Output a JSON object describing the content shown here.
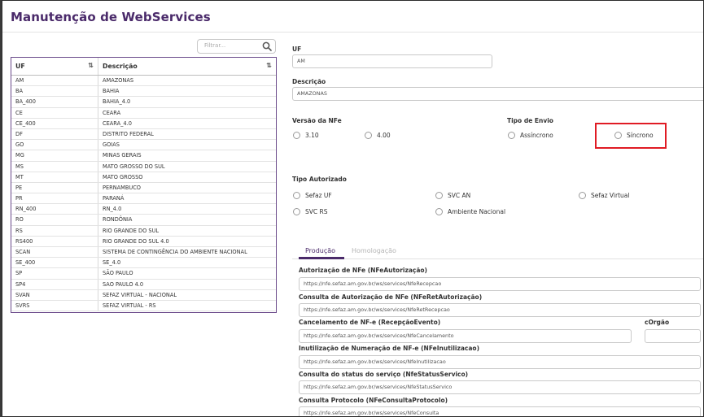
{
  "page_title": "Manutenção de WebServices",
  "filter": {
    "placeholder": "Filtrar...",
    "icon": "search-icon"
  },
  "grid": {
    "headers": [
      "UF",
      "Descrição"
    ],
    "rows": [
      [
        "AM",
        "AMAZONAS"
      ],
      [
        "BA",
        "BAHIA"
      ],
      [
        "BA_400",
        "BAHIA_4.0"
      ],
      [
        "CE",
        "CEARA"
      ],
      [
        "CE_400",
        "CEARA_4.0"
      ],
      [
        "DF",
        "DISTRITO FEDERAL"
      ],
      [
        "GO",
        "GOIAS"
      ],
      [
        "MG",
        "MINAS GERAIS"
      ],
      [
        "MS",
        "MATO GROSSO DO SUL"
      ],
      [
        "MT",
        "MATO GROSSO"
      ],
      [
        "PE",
        "PERNAMBUCO"
      ],
      [
        "PR",
        "PARANÁ"
      ],
      [
        "RN_400",
        "RN_4.0"
      ],
      [
        "RO",
        "RONDÔNIA"
      ],
      [
        "RS",
        "RIO GRANDE DO SUL"
      ],
      [
        "RS400",
        "RIO GRANDE DO SUL 4.0"
      ],
      [
        "SCAN",
        "SISTEMA DE CONTINGÊNCIA DO AMBIENTE NACIONAL"
      ],
      [
        "SE_400",
        "SE_4.0"
      ],
      [
        "SP",
        "SÃO PAULO"
      ],
      [
        "SP4",
        "SAO PAULO 4.0"
      ],
      [
        "SVAN",
        "SEFAZ VIRTUAL - NACIONAL"
      ],
      [
        "SVRS",
        "SEFAZ VIRTUAL - RS"
      ]
    ]
  },
  "form": {
    "uf": {
      "label": "UF",
      "value": "AM"
    },
    "descricao": {
      "label": "Descrição",
      "value": "AMAZONAS"
    },
    "versao": {
      "label": "Versão da NFe",
      "options": [
        "3.10",
        "4.00"
      ]
    },
    "tipo_envio": {
      "label": "Tipo de Envio",
      "options": [
        "Assíncrono",
        "Síncrono"
      ]
    },
    "tipo_autorizado": {
      "label": "Tipo Autorizado",
      "options": [
        "Sefaz UF",
        "SVC AN",
        "Sefaz Virtual",
        "SVC RS",
        "Ambiente Nacional"
      ]
    },
    "tabs": [
      "Produção",
      "Homologação"
    ],
    "services": [
      {
        "label": "Autorização de NFe (NFeAutorização)",
        "value": "https://nfe.sefaz.am.gov.br/ws/services/NfeRecepcao"
      },
      {
        "label": "Consulta de Autorização de NFe (NFeRetAutorização)",
        "value": "https://nfe.sefaz.am.gov.br/ws/services/NfeRetRecepcao"
      },
      {
        "label": "Cancelamento de NF-e (RecepçãoEvento)",
        "value": "https://nfe.sefaz.am.gov.br/ws/services/NfeCancelamento"
      },
      {
        "label": "Inutilização de Numeração de NF-e (NFeInutilizacao)",
        "value": "https://nfe.sefaz.am.gov.br/ws/services/NfeInutilizacao"
      },
      {
        "label": "Consulta do status do serviço (NfeStatusServico)",
        "value": "https://nfe.sefaz.am.gov.br/ws/services/NfeStatusServico"
      },
      {
        "label": "Consulta Protocolo (NFeConsultaProtocolo)",
        "value": "https://nfe.sefaz.am.gov.br/ws/services/NfeConsulta"
      }
    ],
    "corgao": {
      "label": "cOrgão",
      "value": ""
    }
  },
  "colors": {
    "accent": "#4a2a6a",
    "highlight": "#e01b24"
  }
}
